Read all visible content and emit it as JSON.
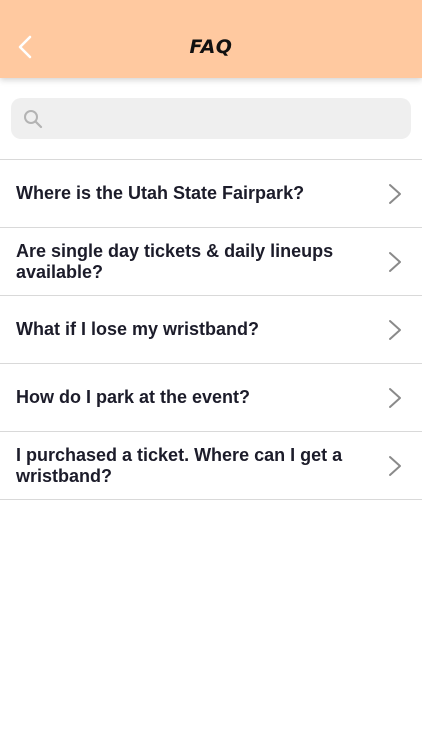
{
  "header": {
    "title": "FAQ",
    "background_color": "#ffc9a0",
    "back_icon": "chevron-left-icon"
  },
  "search": {
    "placeholder": "",
    "value": "",
    "icon": "search-icon"
  },
  "faq": {
    "items": [
      {
        "question": "Where is the Utah State Fairpark?"
      },
      {
        "question": "Are single day tickets & daily lineups available?"
      },
      {
        "question": "What if I lose my wristband?"
      },
      {
        "question": "How do I park at the event?"
      },
      {
        "question": "I purchased a ticket. Where can I get a wristband?"
      }
    ],
    "item_icon": "chevron-right-icon"
  }
}
